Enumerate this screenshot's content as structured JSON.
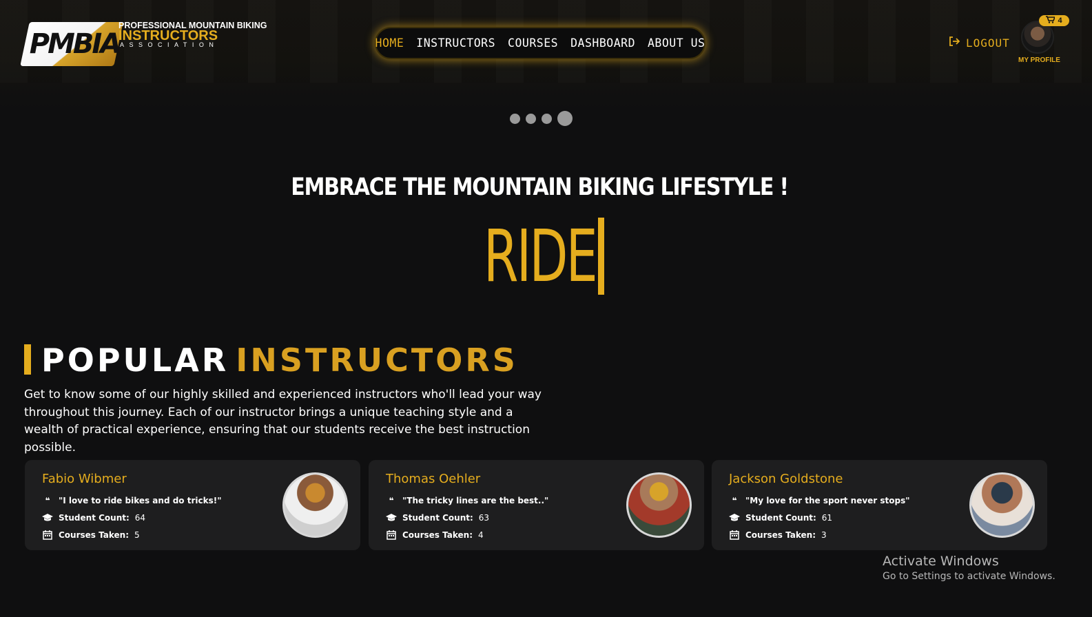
{
  "brand": {
    "mark": "PMBIA",
    "line1": "PROFESSIONAL MOUNTAIN BIKING",
    "line2": "INSTRUCTORS",
    "line3": "ASSOCIATION"
  },
  "nav": {
    "items": [
      {
        "label": "HOME",
        "active": true
      },
      {
        "label": "INSTRUCTORS"
      },
      {
        "label": "COURSES"
      },
      {
        "label": "DASHBOARD"
      },
      {
        "label": "ABOUT US"
      }
    ]
  },
  "header": {
    "logout_label": "LOGOUT",
    "cart_count": "4",
    "profile_label": "MY PROFILE"
  },
  "carousel": {
    "dots": 4,
    "active_index": 3
  },
  "hero": {
    "title": "EMBRACE THE MOUNTAIN BIKING LIFESTYLE !",
    "typed_word": "RIDE"
  },
  "section": {
    "title_white": "POPULAR",
    "title_gold": "INSTRUCTORS",
    "description": "Get to know some of our highly skilled and experienced instructors who'll lead your way throughout this journey. Each of our instructor brings a unique teaching style and a wealth of practical experience, ensuring that our students receive the best instruction possible."
  },
  "instructors": [
    {
      "name": "Fabio Wibmer",
      "quote": "\"I love to ride bikes and do tricks!\"",
      "student_label": "Student Count:",
      "students": "64",
      "courses_label": "Courses Taken:",
      "courses": "5"
    },
    {
      "name": "Thomas Oehler",
      "quote": "\"The tricky lines are the best..\"",
      "student_label": "Student Count:",
      "students": "63",
      "courses_label": "Courses Taken:",
      "courses": "4"
    },
    {
      "name": "Jackson Goldstone",
      "quote": "\"My love for the sport never stops\"",
      "student_label": "Student Count:",
      "students": "61",
      "courses_label": "Courses Taken:",
      "courses": "3"
    }
  ],
  "watermark": {
    "line1": "Activate Windows",
    "line2": "Go to Settings to activate Windows."
  },
  "colors": {
    "accent": "#e5ad1e",
    "background": "#0f0f10",
    "card": "#1e1e1f"
  }
}
